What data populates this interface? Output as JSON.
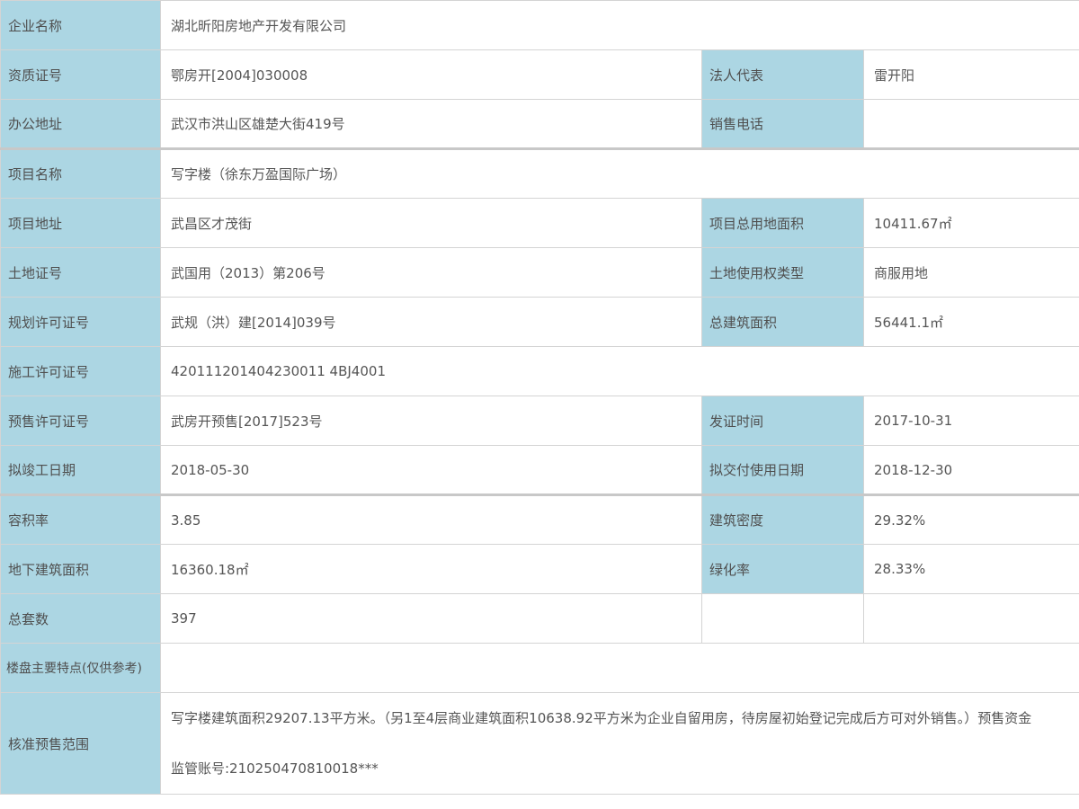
{
  "rows": {
    "company": {
      "label": "企业名称",
      "value": "湖北昕阳房地产开发有限公司"
    },
    "qualification": {
      "label": "资质证号",
      "value": "鄂房开[2004]030008"
    },
    "legal_rep": {
      "label": "法人代表",
      "value": "雷开阳"
    },
    "office_address": {
      "label": "办公地址",
      "value": "武汉市洪山区雄楚大街419号"
    },
    "sales_phone": {
      "label": "销售电话",
      "value": ""
    },
    "project_name": {
      "label": "项目名称",
      "value": "写字楼（徐东万盈国际广场）"
    },
    "project_address": {
      "label": "项目地址",
      "value": "武昌区才茂街"
    },
    "total_land_area": {
      "label": "项目总用地面积",
      "value": "10411.67㎡"
    },
    "land_cert": {
      "label": "土地证号",
      "value": "武国用（2013）第206号"
    },
    "land_use_type": {
      "label": "土地使用权类型",
      "value": "商服用地"
    },
    "planning_permit": {
      "label": "规划许可证号",
      "value": "武规（洪）建[2014]039号"
    },
    "total_floor_area": {
      "label": "总建筑面积",
      "value": "56441.1㎡"
    },
    "construction_permit": {
      "label": "施工许可证号",
      "value": "420111201404230011 4BJ4001"
    },
    "presale_permit": {
      "label": "预售许可证号",
      "value": "武房开预售[2017]523号"
    },
    "issue_date": {
      "label": "发证时间",
      "value": "2017-10-31"
    },
    "planned_completion": {
      "label": "拟竣工日期",
      "value": "2018-05-30"
    },
    "planned_delivery": {
      "label": "拟交付使用日期",
      "value": "2018-12-30"
    },
    "plot_ratio": {
      "label": "容积率",
      "value": "3.85"
    },
    "building_density": {
      "label": "建筑密度",
      "value": "29.32%"
    },
    "underground_area": {
      "label": "地下建筑面积",
      "value": "16360.18㎡"
    },
    "greening_rate": {
      "label": "绿化率",
      "value": "28.33%"
    },
    "total_units": {
      "label": "总套数",
      "value": "397"
    },
    "features": {
      "label": "楼盘主要特点(仅供参考)",
      "value": ""
    },
    "presale_scope": {
      "label": "核准预售范围",
      "line1": "写字楼建筑面积29207.13平方米。（另1至4层商业建筑面积10638.92平方米为企业自留用房，待房屋初始登记完成后方可对外销售。）预售资金",
      "line2": "监管账号:210250470810018***"
    }
  }
}
